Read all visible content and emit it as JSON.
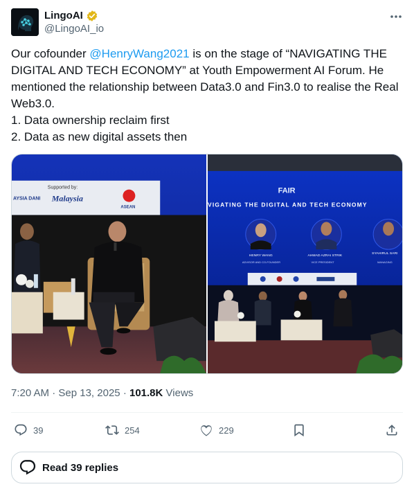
{
  "account": {
    "display_name": "LingoAI",
    "handle": "@LingoAI_io",
    "verified_badge_color": "#e2b719",
    "avatar_icon": "brain-head-icon"
  },
  "tweet": {
    "text_before_mention": "Our cofounder ",
    "mention": "@HenryWang2021",
    "text_after_mention": " is on the stage of “NAVIGATING THE DIGITAL AND TECH ECONOMY” at Youth Empowerment AI Forum. He mentioned the relationship between Data3.0 and Fin3.0 to realise the Real Web3.0.\n1. Data ownership reclaim first\n2. Data as new digital assets then"
  },
  "photos": {
    "left": {
      "banner_label": "Supported by:",
      "sponsor_1": "AYSIA DANI",
      "sponsor_2": "Malaysia",
      "sponsor_3": "ASEAN"
    },
    "right": {
      "event_logo": "FAIR",
      "screen_title": "VIGATING THE DIGITAL AND TECH ECONOMY",
      "speakers": [
        "HENRY WANG",
        "AHMAD AZRAI STRIK",
        "SYAHIRUL SARI"
      ],
      "roles": [
        "ADVISOR AND CO-FOUNDER",
        "VICE PRESIDENT",
        "MANAGING"
      ]
    }
  },
  "meta": {
    "time": "7:20 AM",
    "separator": "·",
    "date": "Sep 13, 2025",
    "views_count": "101.8K",
    "views_label": "Views"
  },
  "actions": {
    "replies": "39",
    "reposts": "254",
    "likes": "229"
  },
  "read_replies_label": "Read 39 replies",
  "colors": {
    "accent": "#1d9bf0",
    "secondary_text": "#536471",
    "border": "#cfd9de"
  }
}
